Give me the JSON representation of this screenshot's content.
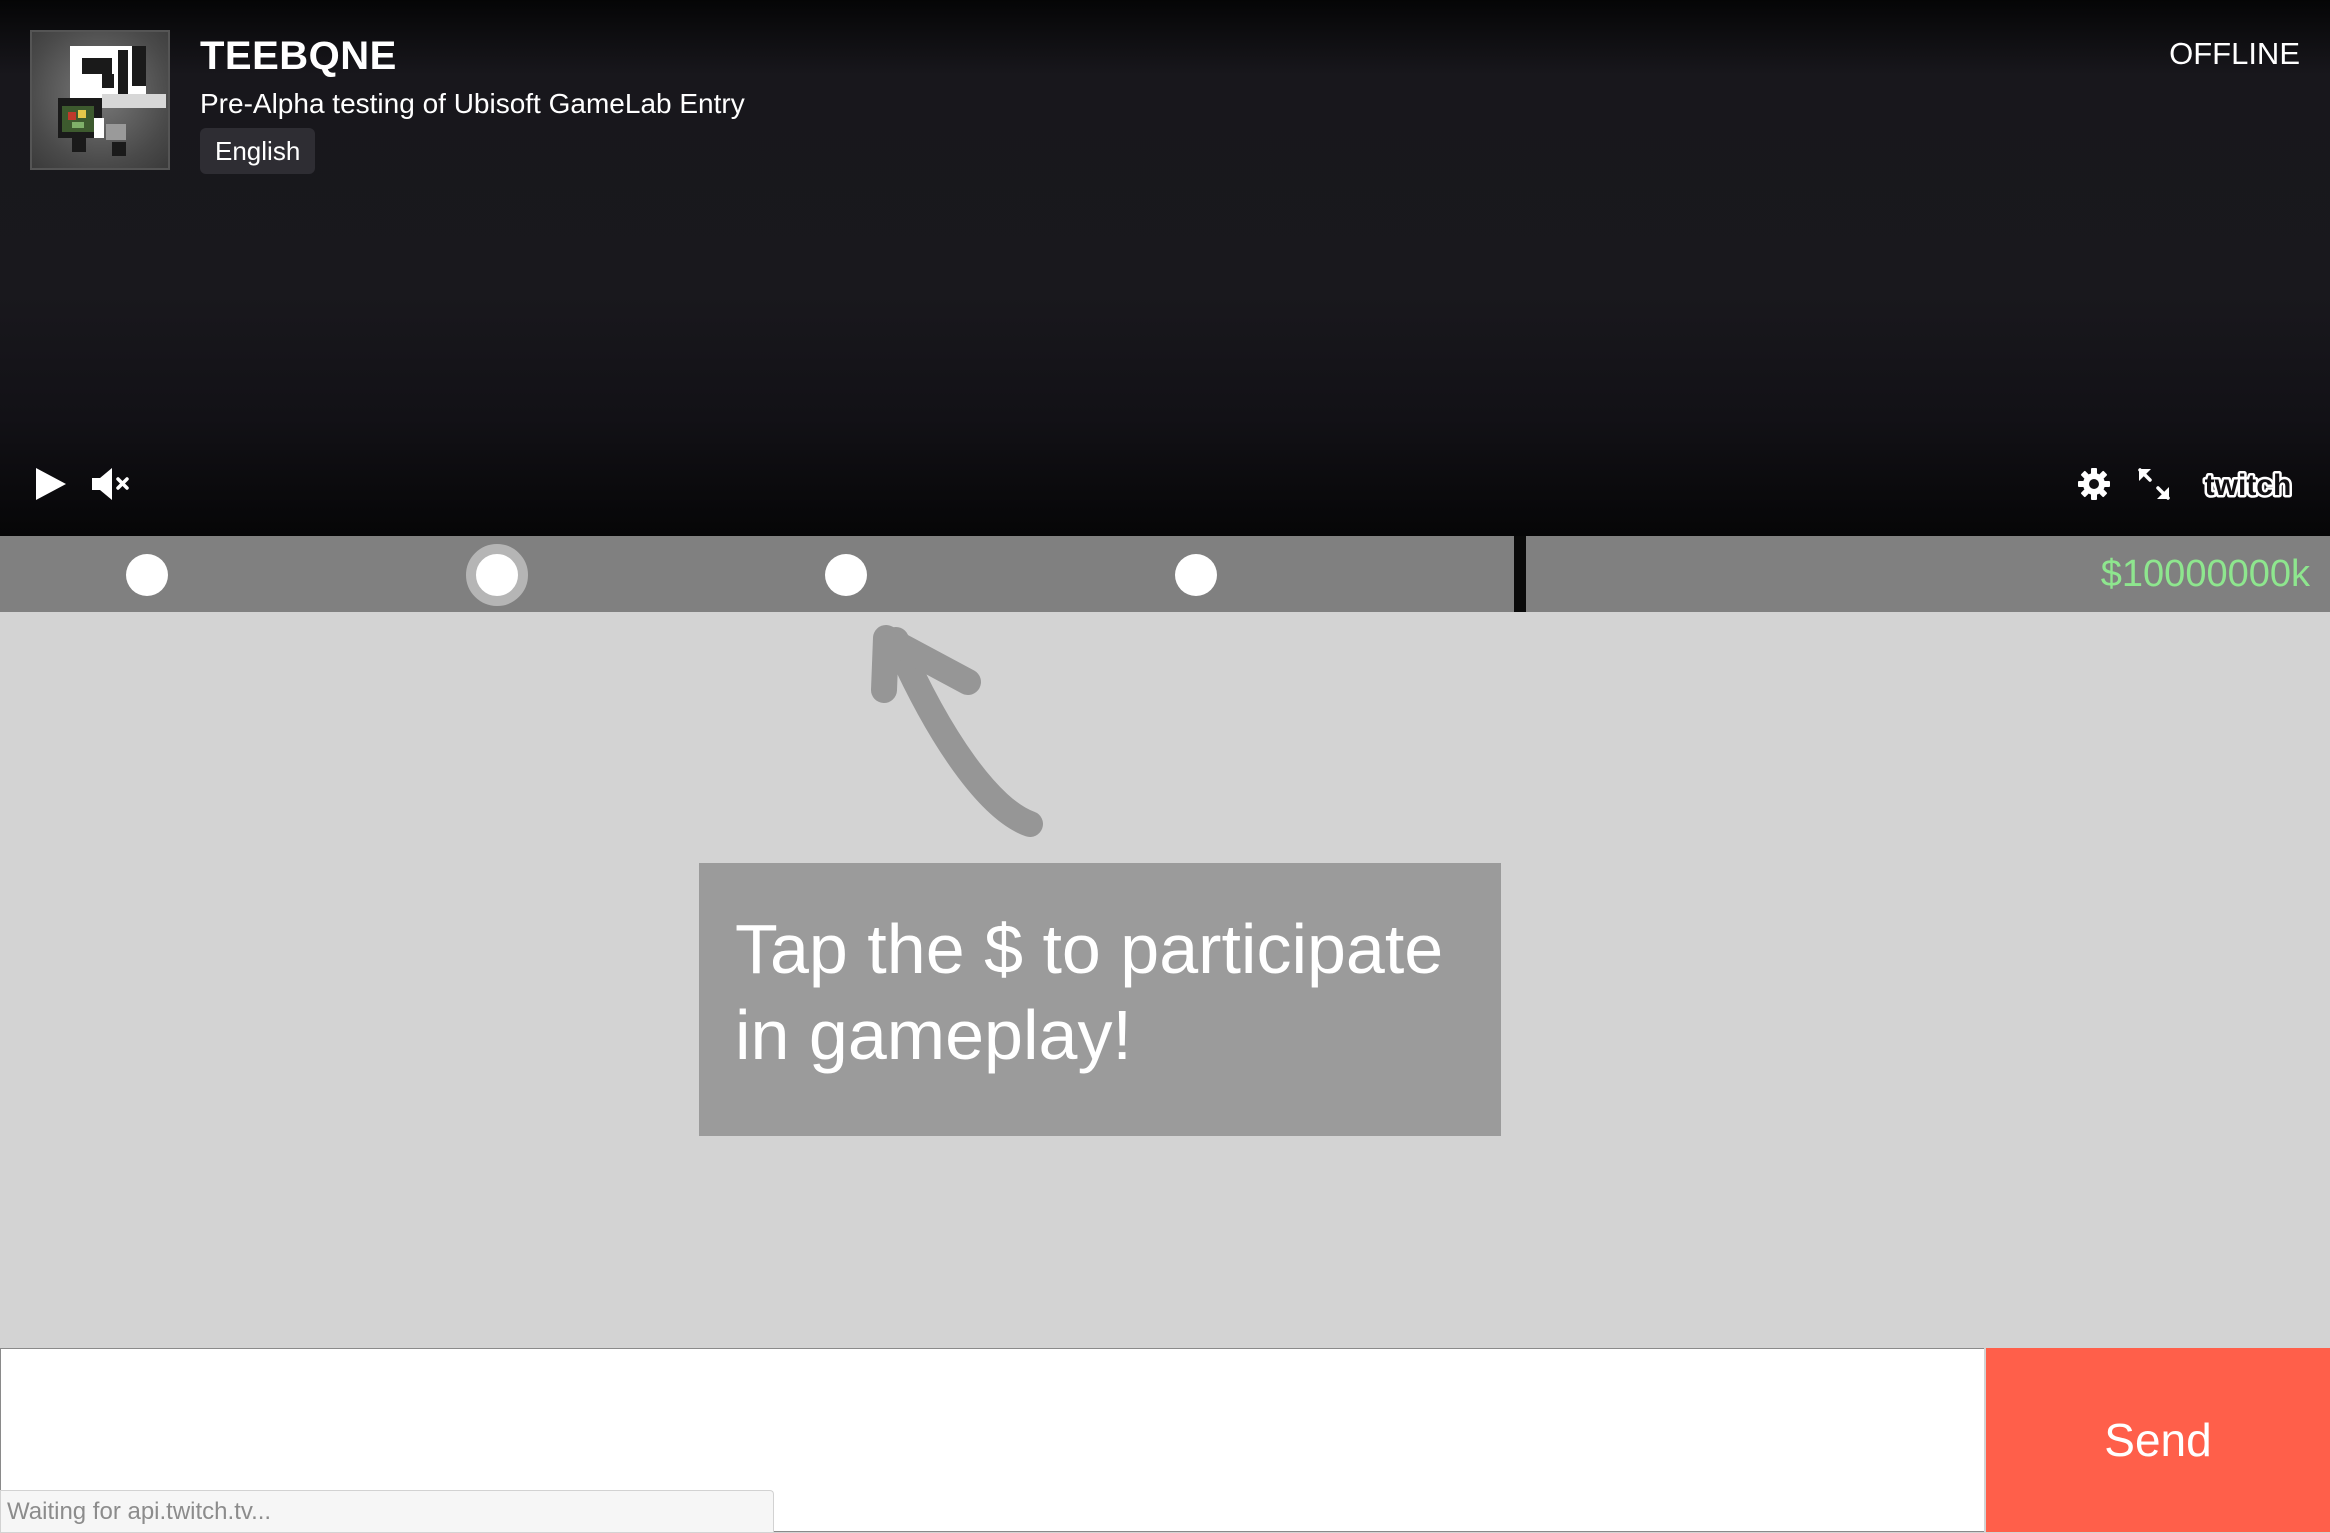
{
  "player": {
    "channel_name": "TEEBQNE",
    "stream_title": "Pre-Alpha testing of Ubisoft GameLab Entry",
    "language_badge": "English",
    "status": "OFFLINE",
    "controls": {
      "play_icon": "play-icon",
      "mute_icon": "muted-speaker-icon",
      "settings_icon": "gear-icon",
      "fullscreen_icon": "expand-icon",
      "brand_icon": "twitch-logo"
    }
  },
  "selection_bar": {
    "slot_count": 4,
    "selected_slot": 2,
    "money": "$10000000k",
    "money_color": "#8ee68e"
  },
  "hint": {
    "text": "Tap the $ to participate in gameplay!"
  },
  "chat": {
    "input_value": "",
    "send_label": "Send",
    "send_color": "#ff5f4a"
  },
  "status_bar": {
    "text": "Waiting for api.twitch.tv..."
  }
}
